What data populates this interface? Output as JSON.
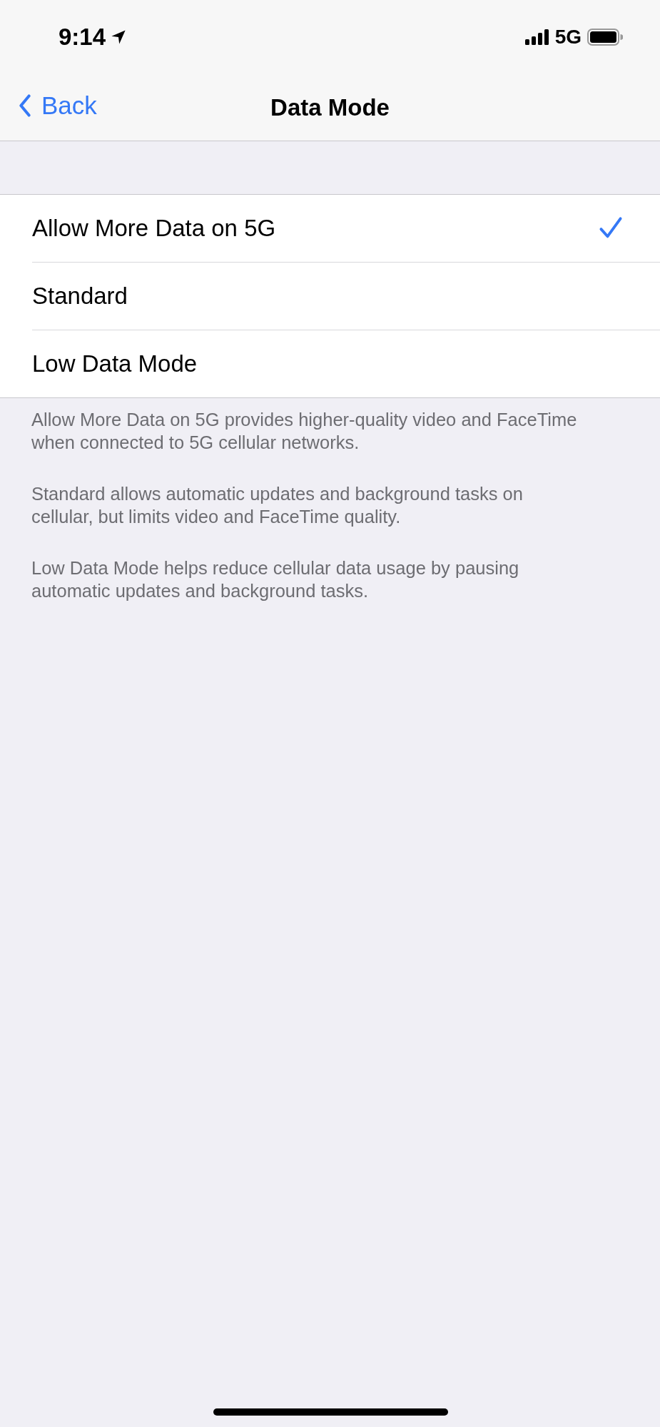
{
  "status_bar": {
    "time": "9:14",
    "network": "5G"
  },
  "nav": {
    "back": "Back",
    "title": "Data Mode"
  },
  "options": [
    {
      "label": "Allow More Data on 5G",
      "selected": true
    },
    {
      "label": "Standard",
      "selected": false
    },
    {
      "label": "Low Data Mode",
      "selected": false
    }
  ],
  "footer": [
    "Allow More Data on 5G provides higher-quality video and FaceTime when connected to 5G cellular networks.",
    "Standard allows automatic updates and background tasks on cellular, but limits video and FaceTime quality.",
    "Low Data Mode helps reduce cellular data usage by pausing automatic updates and background tasks."
  ]
}
